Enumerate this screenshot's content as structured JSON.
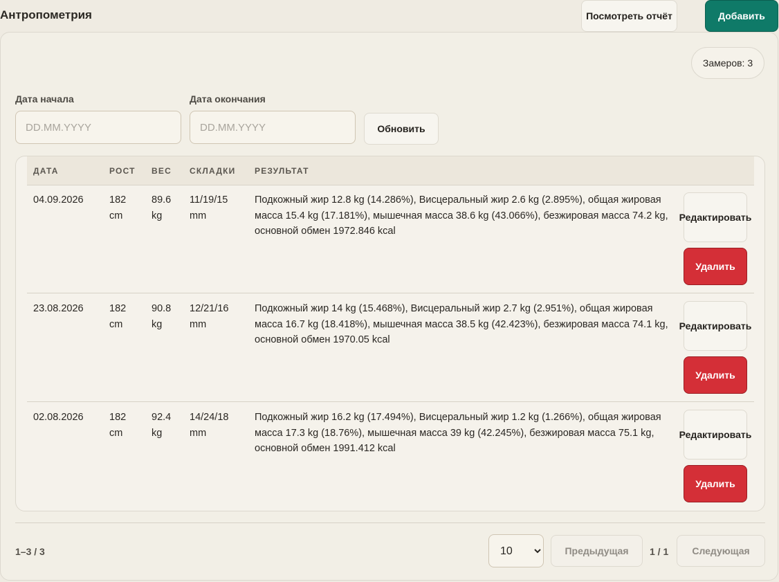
{
  "header": {
    "title": "Антропометрия",
    "view_report_label": "Посмотреть отчёт",
    "add_label": "Добавить"
  },
  "summary": {
    "count_label": "Замеров: 3"
  },
  "filters": {
    "start_label": "Дата начала",
    "end_label": "Дата окончания",
    "start_placeholder": "DD.MM.YYYY",
    "end_placeholder": "DD.MM.YYYY",
    "refresh_label": "Обновить"
  },
  "table": {
    "columns": [
      "ДАТА",
      "РОСТ",
      "ВЕС",
      "СКЛАДКИ",
      "РЕЗУЛЬТАТ"
    ],
    "rows": [
      {
        "date": "04.09.2026",
        "height": "182 cm",
        "weight": "89.6 kg",
        "folds": "11/19/15 mm",
        "result": "Подкожный жир 12.8 kg (14.286%), Висцеральный жир 2.6 kg (2.895%), общая жировая масса 15.4 kg (17.181%), мышечная масса 38.6 kg (43.066%), безжировая масса 74.2 kg, основной обмен 1972.846 kcal"
      },
      {
        "date": "23.08.2026",
        "height": "182 cm",
        "weight": "90.8 kg",
        "folds": "12/21/16 mm",
        "result": "Подкожный жир 14 kg (15.468%), Висцеральный жир 2.7 kg (2.951%), общая жировая масса 16.7 kg (18.418%), мышечная масса 38.5 kg (42.423%), безжировая масса 74.1 kg, основной обмен 1970.05 kcal"
      },
      {
        "date": "02.08.2026",
        "height": "182 cm",
        "weight": "92.4 kg",
        "folds": "14/24/18 mm",
        "result": "Подкожный жир 16.2 kg (17.494%), Висцеральный жир 1.2 kg (1.266%), общая жировая масса 17.3 kg (18.76%), мышечная масса 39 kg (42.245%), безжировая масса 75.1 kg, основной обмен 1991.412 kcal"
      }
    ],
    "edit_label": "Редактировать",
    "delete_label": "Удалить"
  },
  "pagination": {
    "range_label": "1–3 / 3",
    "page_size": "10",
    "page_size_options": [
      "10"
    ],
    "prev_label": "Предыдущая",
    "page_info": "1 / 1",
    "next_label": "Следующая"
  },
  "colors": {
    "background": "#efebe2",
    "accent": "#0f7a68",
    "danger": "#d42f37"
  }
}
